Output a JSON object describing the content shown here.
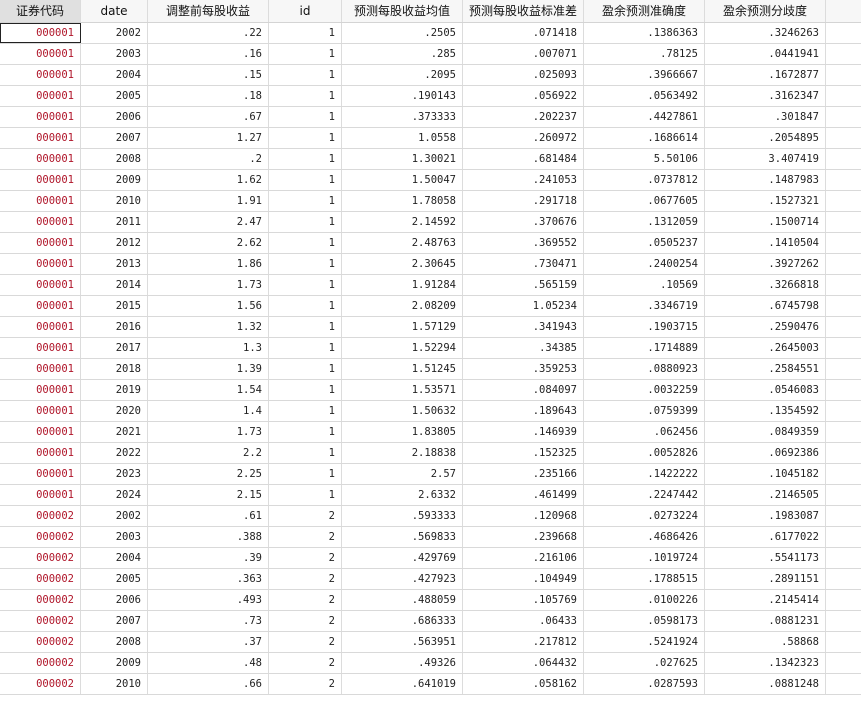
{
  "columns": [
    "证券代码",
    "date",
    "调整前每股收益",
    "id",
    "预测每股收益均值",
    "预测每股收益标准差",
    "盈余预测准确度",
    "盈余预测分歧度"
  ],
  "rows": [
    [
      "000001",
      "2002",
      ".22",
      "1",
      ".2505",
      ".071418",
      ".1386363",
      ".3246263"
    ],
    [
      "000001",
      "2003",
      ".16",
      "1",
      ".285",
      ".007071",
      ".78125",
      ".0441941"
    ],
    [
      "000001",
      "2004",
      ".15",
      "1",
      ".2095",
      ".025093",
      ".3966667",
      ".1672877"
    ],
    [
      "000001",
      "2005",
      ".18",
      "1",
      ".190143",
      ".056922",
      ".0563492",
      ".3162347"
    ],
    [
      "000001",
      "2006",
      ".67",
      "1",
      ".373333",
      ".202237",
      ".4427861",
      ".301847"
    ],
    [
      "000001",
      "2007",
      "1.27",
      "1",
      "1.0558",
      ".260972",
      ".1686614",
      ".2054895"
    ],
    [
      "000001",
      "2008",
      ".2",
      "1",
      "1.30021",
      ".681484",
      "5.50106",
      "3.407419"
    ],
    [
      "000001",
      "2009",
      "1.62",
      "1",
      "1.50047",
      ".241053",
      ".0737812",
      ".1487983"
    ],
    [
      "000001",
      "2010",
      "1.91",
      "1",
      "1.78058",
      ".291718",
      ".0677605",
      ".1527321"
    ],
    [
      "000001",
      "2011",
      "2.47",
      "1",
      "2.14592",
      ".370676",
      ".1312059",
      ".1500714"
    ],
    [
      "000001",
      "2012",
      "2.62",
      "1",
      "2.48763",
      ".369552",
      ".0505237",
      ".1410504"
    ],
    [
      "000001",
      "2013",
      "1.86",
      "1",
      "2.30645",
      ".730471",
      ".2400254",
      ".3927262"
    ],
    [
      "000001",
      "2014",
      "1.73",
      "1",
      "1.91284",
      ".565159",
      ".10569",
      ".3266818"
    ],
    [
      "000001",
      "2015",
      "1.56",
      "1",
      "2.08209",
      "1.05234",
      ".3346719",
      ".6745798"
    ],
    [
      "000001",
      "2016",
      "1.32",
      "1",
      "1.57129",
      ".341943",
      ".1903715",
      ".2590476"
    ],
    [
      "000001",
      "2017",
      "1.3",
      "1",
      "1.52294",
      ".34385",
      ".1714889",
      ".2645003"
    ],
    [
      "000001",
      "2018",
      "1.39",
      "1",
      "1.51245",
      ".359253",
      ".0880923",
      ".2584551"
    ],
    [
      "000001",
      "2019",
      "1.54",
      "1",
      "1.53571",
      ".084097",
      ".0032259",
      ".0546083"
    ],
    [
      "000001",
      "2020",
      "1.4",
      "1",
      "1.50632",
      ".189643",
      ".0759399",
      ".1354592"
    ],
    [
      "000001",
      "2021",
      "1.73",
      "1",
      "1.83805",
      ".146939",
      ".062456",
      ".0849359"
    ],
    [
      "000001",
      "2022",
      "2.2",
      "1",
      "2.18838",
      ".152325",
      ".0052826",
      ".0692386"
    ],
    [
      "000001",
      "2023",
      "2.25",
      "1",
      "2.57",
      ".235166",
      ".1422222",
      ".1045182"
    ],
    [
      "000001",
      "2024",
      "2.15",
      "1",
      "2.6332",
      ".461499",
      ".2247442",
      ".2146505"
    ],
    [
      "000002",
      "2002",
      ".61",
      "2",
      ".593333",
      ".120968",
      ".0273224",
      ".1983087"
    ],
    [
      "000002",
      "2003",
      ".388",
      "2",
      ".569833",
      ".239668",
      ".4686426",
      ".6177022"
    ],
    [
      "000002",
      "2004",
      ".39",
      "2",
      ".429769",
      ".216106",
      ".1019724",
      ".5541173"
    ],
    [
      "000002",
      "2005",
      ".363",
      "2",
      ".427923",
      ".104949",
      ".1788515",
      ".2891151"
    ],
    [
      "000002",
      "2006",
      ".493",
      "2",
      ".488059",
      ".105769",
      ".0100226",
      ".2145414"
    ],
    [
      "000002",
      "2007",
      ".73",
      "2",
      ".686333",
      ".06433",
      ".0598173",
      ".0881231"
    ],
    [
      "000002",
      "2008",
      ".37",
      "2",
      ".563951",
      ".217812",
      ".5241924",
      ".58868"
    ],
    [
      "000002",
      "2009",
      ".48",
      "2",
      ".49326",
      ".064432",
      ".027625",
      ".1342323"
    ],
    [
      "000002",
      "2010",
      ".66",
      "2",
      ".641019",
      ".058162",
      ".0287593",
      ".0881248"
    ]
  ]
}
